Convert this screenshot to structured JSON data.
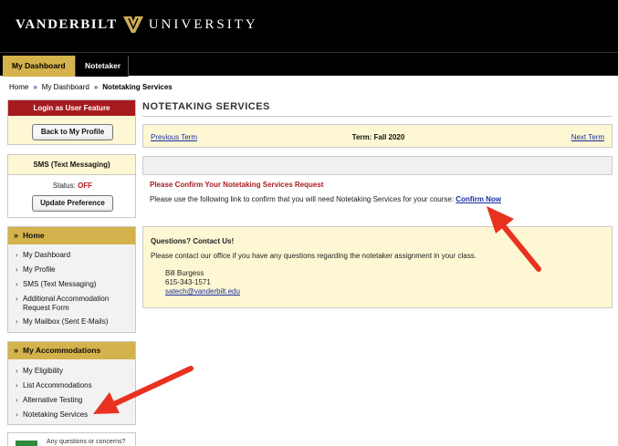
{
  "header": {
    "logo_left": "VANDERBILT",
    "logo_right": "UNIVERSITY"
  },
  "topnav": {
    "tabs": [
      {
        "label": "My Dashboard"
      },
      {
        "label": "Notetaker"
      }
    ]
  },
  "breadcrumb": {
    "items": [
      "Home",
      "My Dashboard",
      "Notetaking Services"
    ],
    "separator": "»"
  },
  "sidebar": {
    "login_feature": {
      "title": "Login as User Feature",
      "button": "Back to My Profile"
    },
    "sms": {
      "title": "SMS (Text Messaging)",
      "status_label": "Status:",
      "status_value": "OFF",
      "button": "Update Preference"
    },
    "home_menu": {
      "title": "Home",
      "items": [
        {
          "label": "My Dashboard"
        },
        {
          "label": "My Profile"
        },
        {
          "label": "SMS (Text Messaging)"
        },
        {
          "label": "Additional Accommodation Request Form"
        },
        {
          "label": "My Mailbox (Sent E-Mails)"
        }
      ]
    },
    "accommodations_menu": {
      "title": "My Accommodations",
      "items": [
        {
          "label": "My Eligibility"
        },
        {
          "label": "List Accommodations"
        },
        {
          "label": "Alternative Testing"
        },
        {
          "label": "Notetaking Services"
        }
      ]
    },
    "bottom_box_text": "Any questions or concerns?"
  },
  "main": {
    "title": "NOTETAKING SERVICES",
    "term_nav": {
      "previous": "Previous Term",
      "current": "Term: Fall 2020",
      "next": "Next Term"
    },
    "request": {
      "title": "Please Confirm Your Notetaking Services Request",
      "text": "Please use the following link to confirm that you will need Notetaking Services for your course:",
      "link": "Confirm Now"
    },
    "contact": {
      "heading": "Questions? Contact Us!",
      "text": "Please contact our office if you have any questions regarding the notetaker assignment in your class.",
      "name": "Bill Burgess",
      "phone": "615-343-1571",
      "email": "satech@vanderbilt.edu"
    }
  },
  "colors": {
    "gold": "#d4b24c",
    "cream": "#fdf8d3",
    "red": "#a71b1f",
    "link": "#1a2ea0",
    "annotation_arrow": "#e8321f"
  },
  "icons": [
    "vanderbilt-v-logo-icon",
    "chevron-right-icon",
    "double-chevron-down-icon",
    "red-arrow-annotation"
  ]
}
